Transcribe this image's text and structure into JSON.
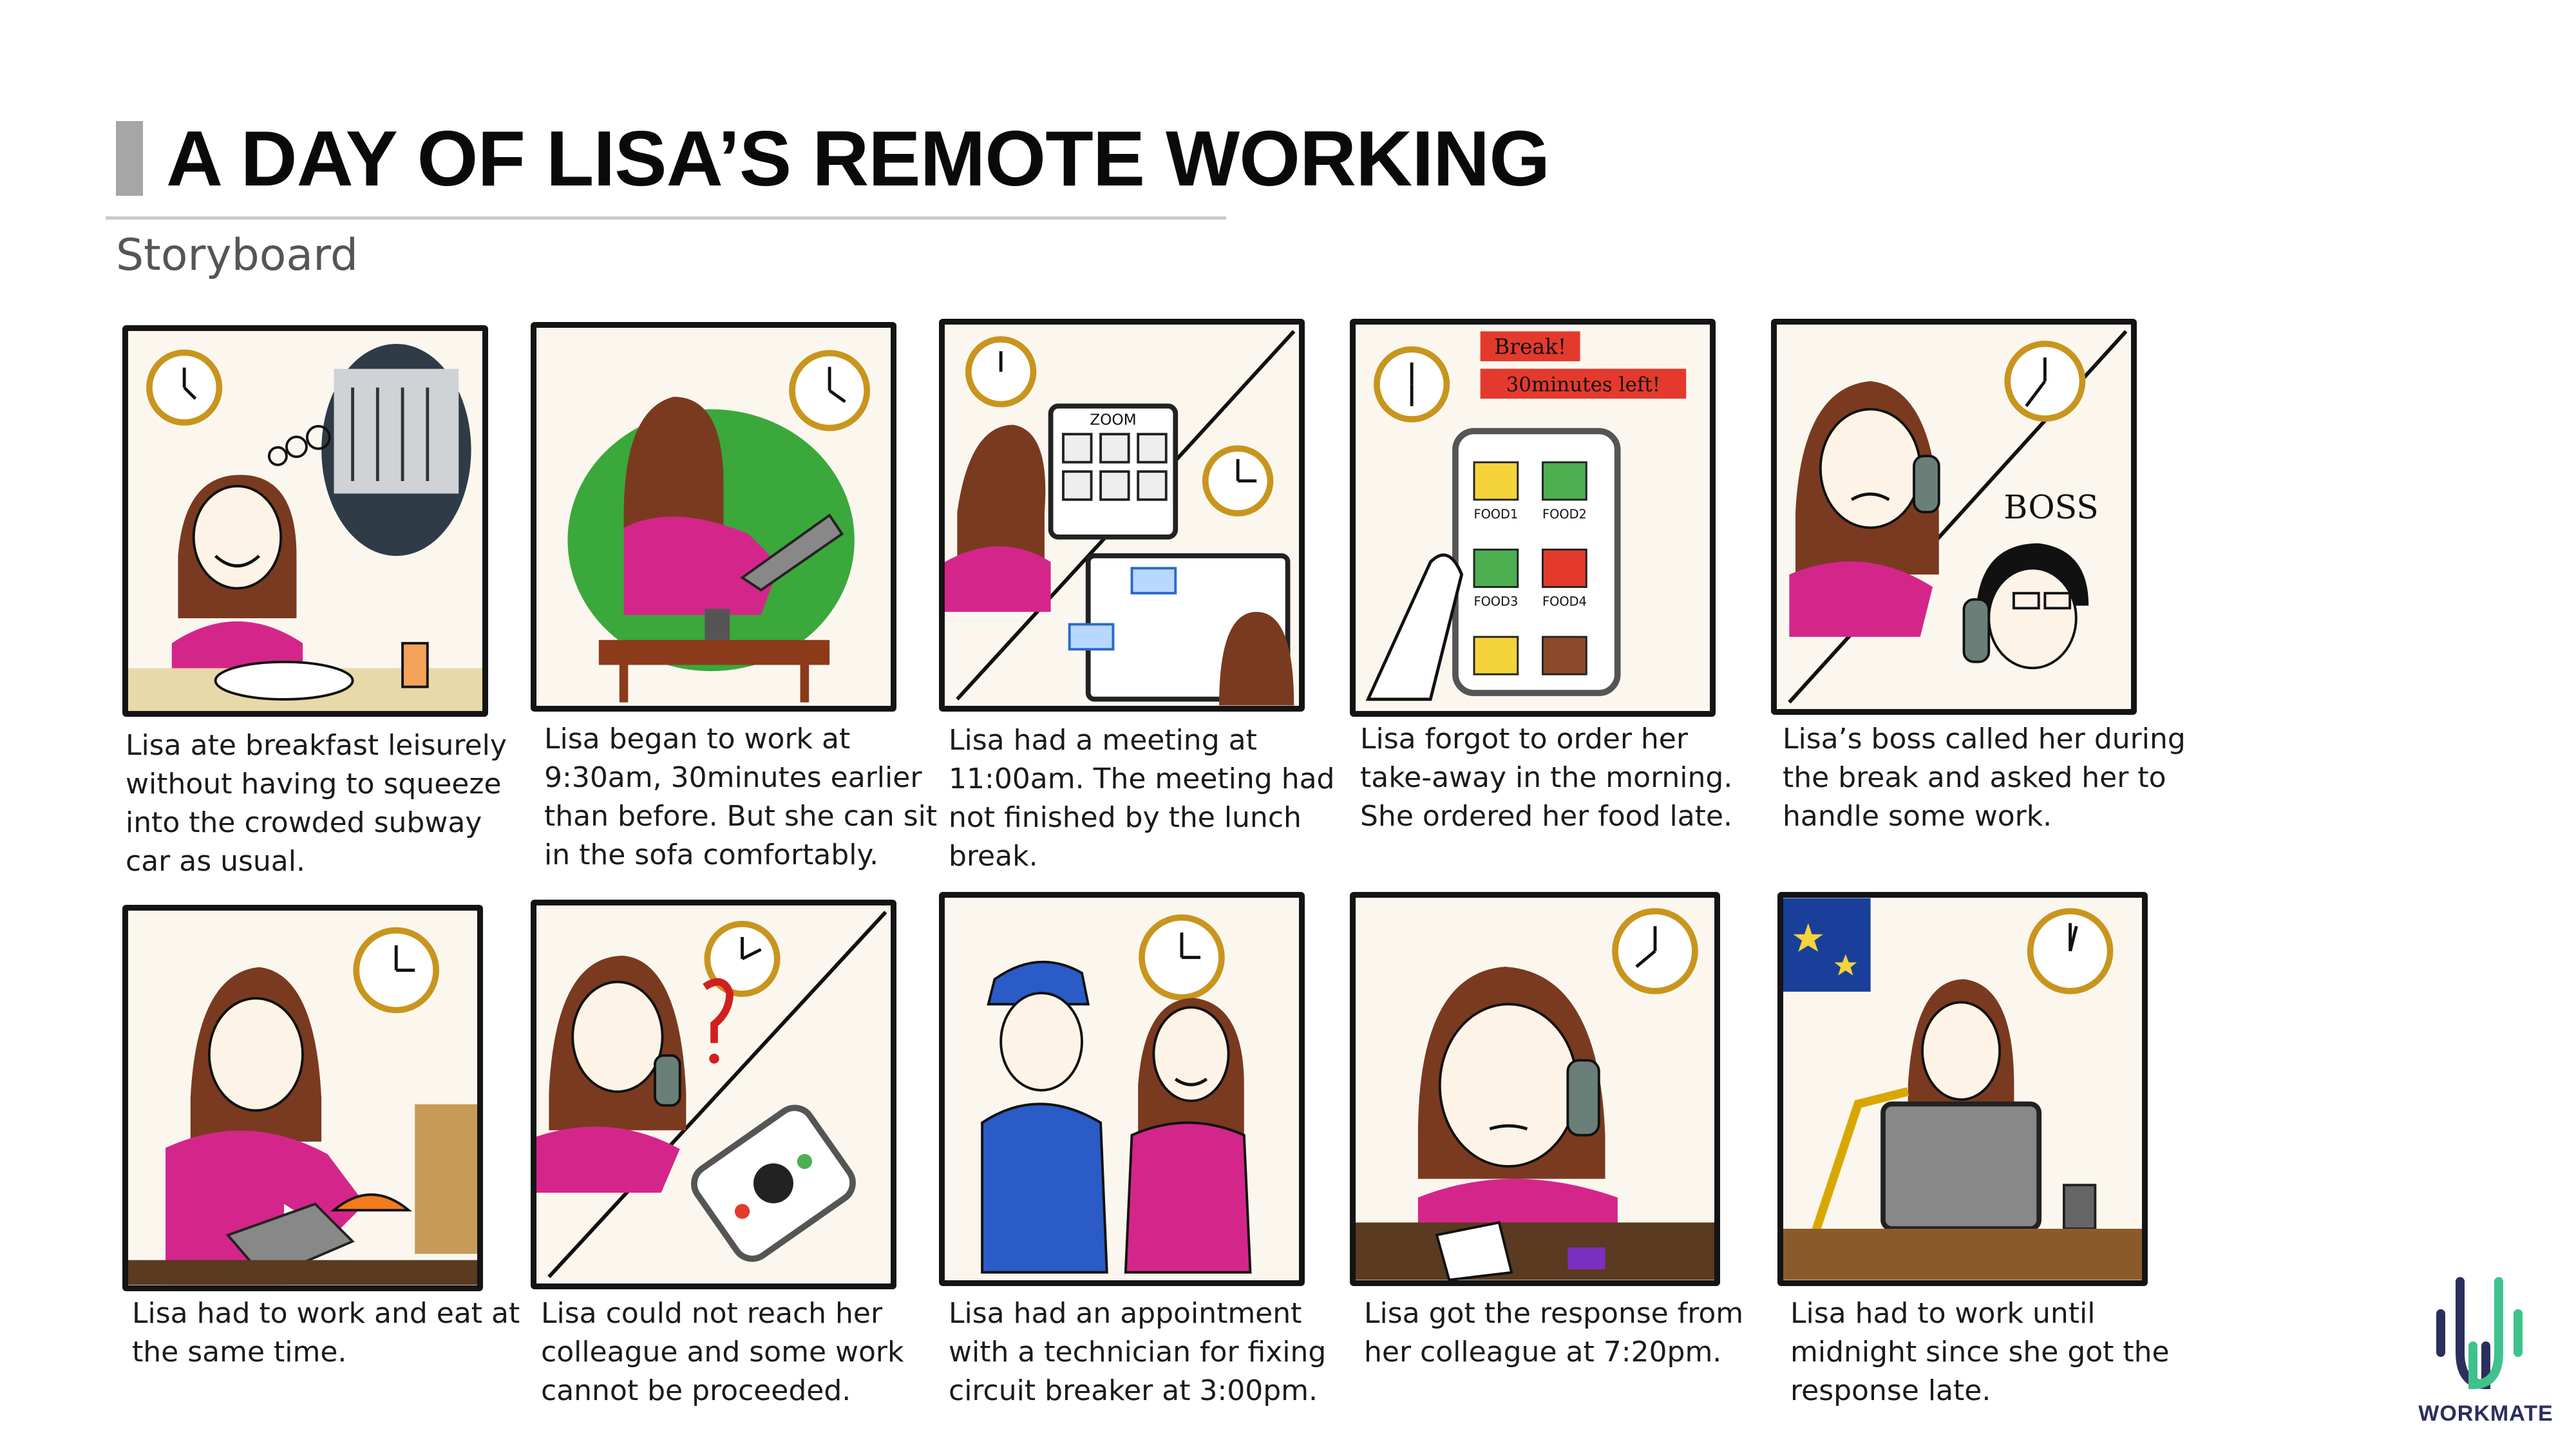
{
  "header": {
    "title": "A DAY OF LISA’S REMOTE WORKING",
    "subtitle": "Storyboard"
  },
  "panels": [
    {
      "caption": "Lisa ate breakfast leisurely\nwithout having to squeeze\ninto the crowded subway\ncar as usual."
    },
    {
      "caption": "Lisa began to work at\n9:30am, 30minutes earlier\nthan before. But she can sit\nin the sofa comfortably."
    },
    {
      "caption": "Lisa had a meeting at\n11:00am. The meeting had\nnot finished by the lunch\nbreak.",
      "screen_label": "ZOOM"
    },
    {
      "caption": "Lisa forgot to order her\ntake-away in the morning.\nShe ordered her food late.",
      "banner_1": "Break!",
      "banner_2": "30minutes left!",
      "food_labels": [
        "FOOD1",
        "FOOD2",
        "FOOD3",
        "FOOD4"
      ]
    },
    {
      "caption": "Lisa’s boss called her during\nthe break and asked her to\nhandle some work.",
      "label": "BOSS"
    },
    {
      "caption": "Lisa had to work and eat at\nthe same time."
    },
    {
      "caption": "Lisa could not reach her\ncolleague and some work\ncannot be proceeded."
    },
    {
      "caption": "Lisa had an appointment\nwith a technician for fixing\ncircuit breaker at 3:00pm."
    },
    {
      "caption": "Lisa got the response from\nher colleague at 7:20pm."
    },
    {
      "caption": "Lisa had to work until\nmidnight since she got the\nresponse late."
    }
  ],
  "logo": {
    "text": "WORKMATE"
  }
}
